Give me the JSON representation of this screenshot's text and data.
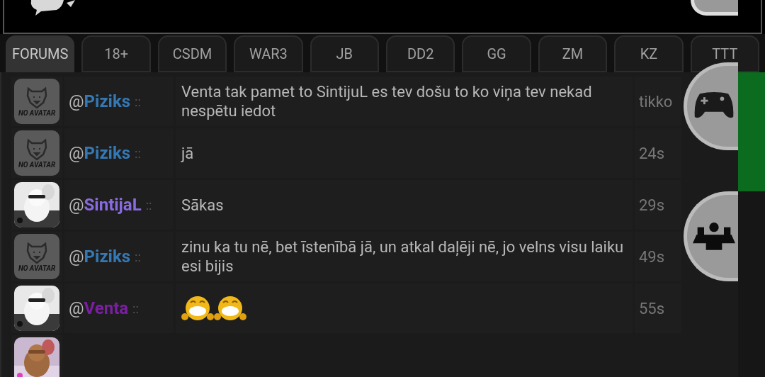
{
  "tabs": [
    {
      "label": "FORUMS",
      "selected": true
    },
    {
      "label": "18+",
      "selected": false
    },
    {
      "label": "CSDM",
      "selected": false
    },
    {
      "label": "WAR3",
      "selected": false
    },
    {
      "label": "JB",
      "selected": false
    },
    {
      "label": "DD2",
      "selected": false
    },
    {
      "label": "GG",
      "selected": false
    },
    {
      "label": "ZM",
      "selected": false
    },
    {
      "label": "KZ",
      "selected": false
    },
    {
      "label": "TTT",
      "selected": false
    }
  ],
  "chat": {
    "rows": [
      {
        "avatar": {
          "kind": "no-avatar",
          "label": "NO AVATAR"
        },
        "prefix": "@",
        "name": "Piziks",
        "color": "#3578b4",
        "separator": "::",
        "message": {
          "kind": "text",
          "text": "Venta tak pamet to SintijuL es tev došu to ko viņa tev nekad nespētu iedot"
        },
        "time": "tikko"
      },
      {
        "avatar": {
          "kind": "no-avatar",
          "label": "NO AVATAR"
        },
        "prefix": "@",
        "name": "Piziks",
        "color": "#3578b4",
        "separator": "::",
        "message": {
          "kind": "text",
          "text": "jā"
        },
        "time": "24s"
      },
      {
        "avatar": {
          "kind": "picture"
        },
        "prefix": "@",
        "name": "SintijaL",
        "color": "#8a6ae0",
        "separator": "::",
        "message": {
          "kind": "text",
          "text": "Sākas"
        },
        "time": "29s"
      },
      {
        "avatar": {
          "kind": "no-avatar",
          "label": "NO AVATAR"
        },
        "prefix": "@",
        "name": "Piziks",
        "color": "#3578b4",
        "separator": "::",
        "message": {
          "kind": "text",
          "text": "zinu ka tu nē, bet īstenībā jā, un atkal daļēji nē, jo velns visu laiku esi bijis"
        },
        "time": "49s"
      },
      {
        "avatar": {
          "kind": "picture"
        },
        "prefix": "@",
        "name": "Venta",
        "color": "#7a1fa0",
        "separator": "::",
        "message": {
          "kind": "emoji",
          "emojis": [
            {
              "kind": "laughing"
            },
            {
              "kind": "laughing"
            }
          ]
        },
        "time": "55s"
      },
      {
        "avatar": {
          "kind": "picture"
        }
      }
    ]
  }
}
